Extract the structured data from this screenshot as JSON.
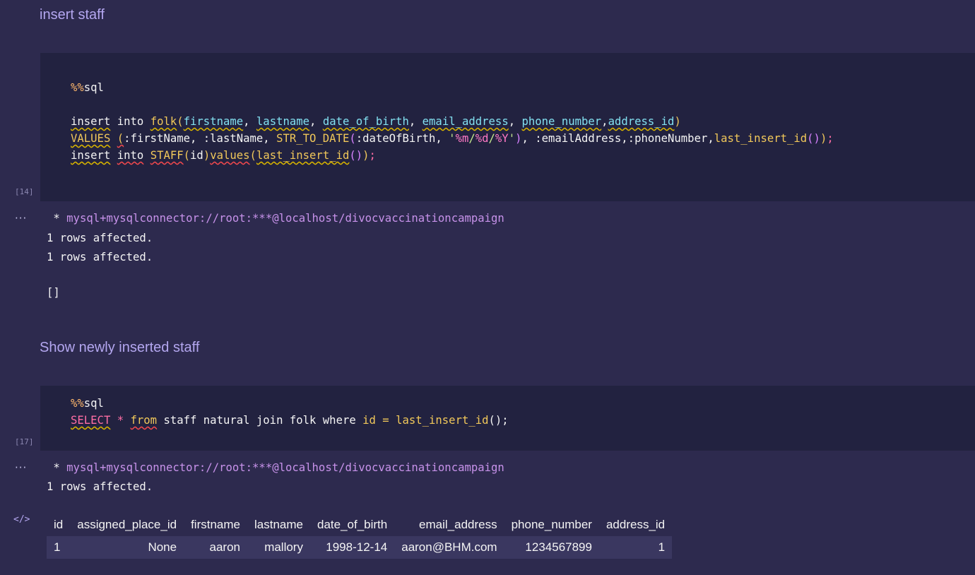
{
  "cells": {
    "md1": {
      "text": "insert staff"
    },
    "code1": {
      "exec_count": "[14]",
      "magic": "sql",
      "magic_prefix": "%%",
      "line2": {
        "insert": "insert",
        "into": "into",
        "table": "folk",
        "open": "(",
        "cols": [
          "firstname",
          "lastname",
          "date_of_birth",
          "email_address",
          "phone_number",
          "address_id"
        ],
        "close": ")"
      },
      "line3": {
        "values": "VALUES",
        "open": "(",
        "p1": ":firstName, :lastName, ",
        "fn": "STR_TO_DATE",
        "arg": ":dateOfBirth, ",
        "q1": "'",
        "f1": "%m",
        "s1": "/",
        "f2": "%d",
        "s2": "/",
        "f3": "%Y",
        "q2": "'",
        "close_fn": ")",
        "p2": ", :emailAddress,:phoneNumber,",
        "fn2": "last_insert_id",
        "paren_inner": "()",
        "close": ")",
        "semi": ";"
      },
      "line4": {
        "insert": "insert",
        "into": "into",
        "table": "STAFF",
        "open": "(",
        "col": "id",
        "close": ")",
        "values": "values",
        "vopen": "(",
        "fn": "last_insert_id",
        "paren_inner": "()",
        "vclose": ")",
        "semi": ";"
      }
    },
    "output1": {
      "dots": "···",
      "connection_prefix": " * ",
      "connection": "mysql+mysqlconnector://root:***@localhost/divocvaccinationcampaign",
      "line1": "1 rows affected.",
      "line2": "1 rows affected.",
      "result": "[]"
    },
    "md2": {
      "text": "Show newly inserted staff"
    },
    "code2": {
      "exec_count": "[17]",
      "magic": "sql",
      "magic_prefix": "%%",
      "select": "SELECT",
      "star": "*",
      "from": "from",
      "rest": "staff natural join folk where",
      "col": "id",
      "eq": "=",
      "fn": "last_insert_id",
      "parens": "()",
      "semi": ";"
    },
    "output2": {
      "dots": "···",
      "html_icon": "</>",
      "connection_prefix": " * ",
      "connection": "mysql+mysqlconnector://root:***@localhost/divocvaccinationcampaign",
      "line1": "1 rows affected.",
      "table": {
        "headers": [
          "id",
          "assigned_place_id",
          "firstname",
          "lastname",
          "date_of_birth",
          "email_address",
          "phone_number",
          "address_id"
        ],
        "rows": [
          [
            "1",
            "None",
            "aaron",
            "mallory",
            "1998-12-14",
            "aaron@BHM.com",
            "1234567899",
            "1"
          ]
        ]
      }
    }
  }
}
